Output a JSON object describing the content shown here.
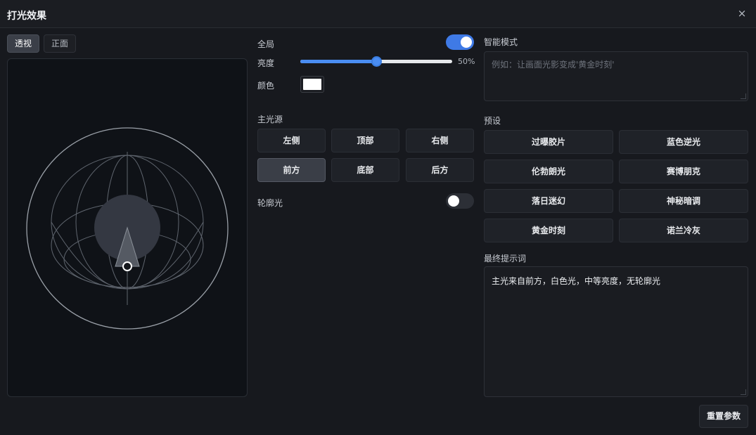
{
  "dialog": {
    "title": "打光效果",
    "close_label": "×"
  },
  "view_tabs": [
    {
      "label": "透视",
      "active": true
    },
    {
      "label": "正面",
      "active": false
    }
  ],
  "global": {
    "label": "全局",
    "enabled": true
  },
  "brightness": {
    "label": "亮度",
    "value": 50,
    "value_text": "50%"
  },
  "color": {
    "label": "颜色",
    "value": "#ffffff"
  },
  "main_light": {
    "label": "主光源",
    "buttons": [
      {
        "label": "左侧",
        "active": false
      },
      {
        "label": "顶部",
        "active": false
      },
      {
        "label": "右侧",
        "active": false
      },
      {
        "label": "前方",
        "active": true
      },
      {
        "label": "底部",
        "active": false
      },
      {
        "label": "后方",
        "active": false
      }
    ]
  },
  "rim_light": {
    "label": "轮廓光",
    "enabled": false
  },
  "smart_mode": {
    "label": "智能模式",
    "placeholder": "例如：让画面光影变成'黄金时刻'"
  },
  "presets": {
    "label": "预设",
    "items": [
      "过曝胶片",
      "蓝色逆光",
      "伦勃朗光",
      "赛博朋克",
      "落日迷幻",
      "神秘暗调",
      "黄金时刻",
      "诺兰冷灰"
    ]
  },
  "final_prompt": {
    "label": "最终提示词",
    "value": "主光来自前方，白色光，中等亮度，无轮廓光"
  },
  "reset": {
    "label": "重置参数"
  },
  "colors": {
    "accent": "#3f7ae6",
    "slider": "#4a8df2",
    "background": "#17191e",
    "panel": "#1f2228"
  }
}
